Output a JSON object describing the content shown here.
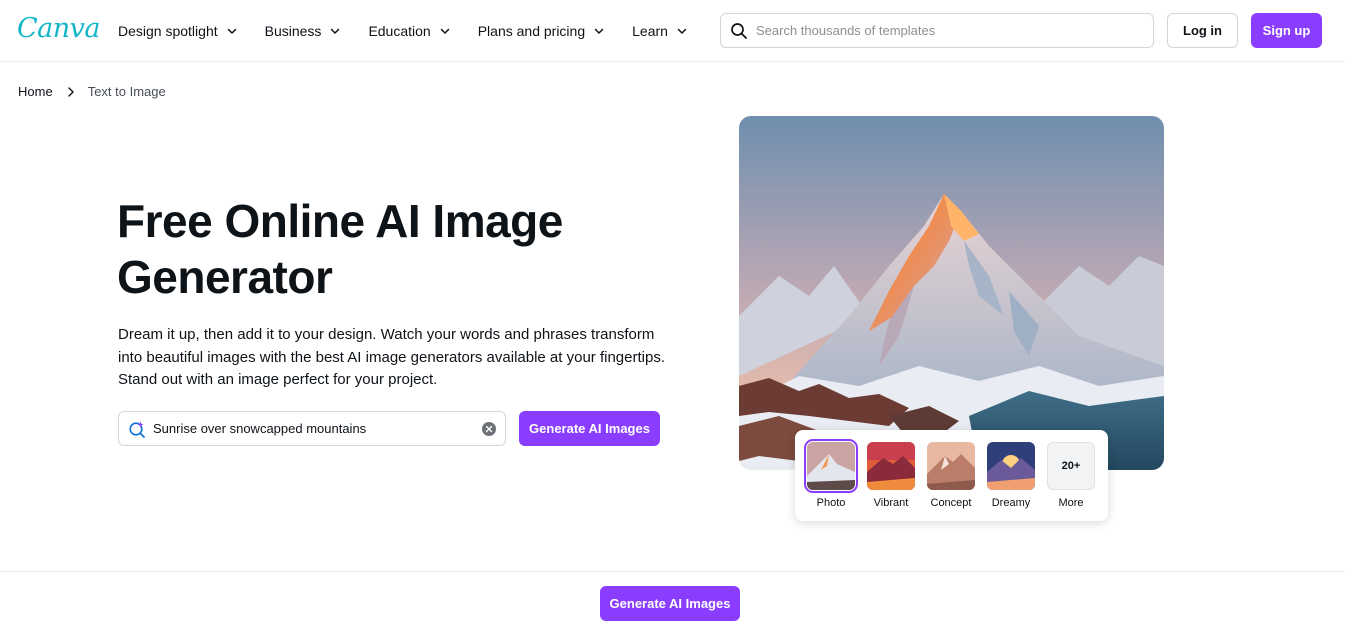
{
  "brand": {
    "logo_text": "Canva",
    "accent": "#8b3dff",
    "logo_color": "#14b6c8"
  },
  "nav": {
    "items": [
      {
        "label": "Design spotlight",
        "icon": "chevron-down-icon"
      },
      {
        "label": "Business",
        "icon": "chevron-down-icon"
      },
      {
        "label": "Education",
        "icon": "chevron-down-icon"
      },
      {
        "label": "Plans and pricing",
        "icon": "chevron-down-icon"
      },
      {
        "label": "Learn",
        "icon": "chevron-down-icon"
      }
    ]
  },
  "search": {
    "placeholder": "Search thousands of templates",
    "icon": "search-icon"
  },
  "auth": {
    "login_label": "Log in",
    "signup_label": "Sign up"
  },
  "breadcrumb": {
    "home": "Home",
    "current": "Text to Image"
  },
  "hero": {
    "title": "Free Online AI Image Generator",
    "description": "Dream it up, then add it to your design. Watch your words and phrases transform into beautiful images with the best AI image generators available at your fingertips. Stand out with an image perfect for your project.",
    "prompt_value": "Sunrise over snowcapped mountains",
    "generate_label": "Generate AI Images"
  },
  "styles": {
    "options": [
      {
        "label": "Photo",
        "selected": true
      },
      {
        "label": "Vibrant",
        "selected": false
      },
      {
        "label": "Concept",
        "selected": false
      },
      {
        "label": "Dreamy",
        "selected": false
      }
    ],
    "more_count": "20+",
    "more_label": "More"
  },
  "bottom_bar": {
    "generate_label": "Generate AI Images"
  }
}
